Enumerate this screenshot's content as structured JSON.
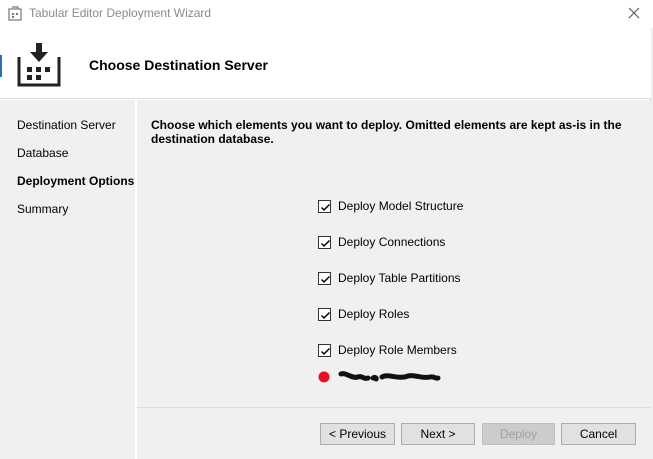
{
  "window": {
    "title": "Tabular Editor Deployment Wizard",
    "close_glyph": "✕"
  },
  "header": {
    "title": "Choose Destination Server",
    "icon": "deploy-download-icon"
  },
  "nav": {
    "items": [
      {
        "label": "Destination Server",
        "active": false
      },
      {
        "label": "Database",
        "active": false
      },
      {
        "label": "Deployment Options",
        "active": true
      },
      {
        "label": "Summary",
        "active": false
      }
    ]
  },
  "content": {
    "instructions": "Choose which elements you want to deploy. Omitted elements are kept as-is in the destination database.",
    "options": [
      {
        "label": "Deploy Model Structure",
        "checked": true
      },
      {
        "label": "Deploy Connections",
        "checked": true
      },
      {
        "label": "Deploy Table Partitions",
        "checked": true
      },
      {
        "label": "Deploy Roles",
        "checked": true
      },
      {
        "label": "Deploy Role Members",
        "checked": true
      }
    ],
    "status_dot_color": "#e81123"
  },
  "footer": {
    "previous": "< Previous",
    "next": "Next >",
    "deploy": "Deploy",
    "cancel": "Cancel"
  },
  "colors": {
    "panel": "#f0f0f0",
    "button": "#e1e1e1",
    "button_disabled": "#cccccc",
    "accent_dot": "#e81123"
  }
}
